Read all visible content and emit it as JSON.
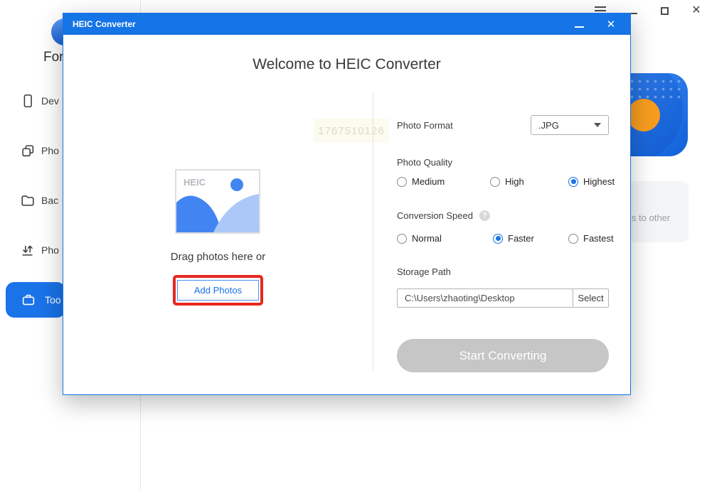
{
  "icons": {
    "close_glyph": "✕",
    "help_glyph": "?"
  },
  "background_app": {
    "logo_text": "For",
    "sidebar_items": [
      {
        "label": "Dev",
        "selected": false
      },
      {
        "label": "Pho",
        "selected": false
      },
      {
        "label": "Bac",
        "selected": false
      },
      {
        "label": "Pho",
        "selected": false
      },
      {
        "label": "Too",
        "selected": true
      }
    ],
    "promo_card_text": "s to other"
  },
  "dialog": {
    "title": "HEIC Converter",
    "heading": "Welcome to HEIC Converter",
    "watermark": "1767510126",
    "left_panel": {
      "thumb_label": "HEIC",
      "drag_text": "Drag photos here or",
      "add_photos_label": "Add Photos"
    },
    "options": {
      "photo_format": {
        "label": "Photo Format",
        "value": ".JPG"
      },
      "photo_quality": {
        "label": "Photo Quality",
        "choices": [
          {
            "label": "Medium",
            "selected": false
          },
          {
            "label": "High",
            "selected": false
          },
          {
            "label": "Highest",
            "selected": true
          }
        ]
      },
      "conversion_speed": {
        "label": "Conversion Speed",
        "choices": [
          {
            "label": "Normal",
            "selected": false
          },
          {
            "label": "Faster",
            "selected": true
          },
          {
            "label": "Fastest",
            "selected": false
          }
        ]
      },
      "storage_path": {
        "label": "Storage Path",
        "value": "C:\\Users\\zhaoting\\Desktop",
        "select_label": "Select"
      }
    },
    "start_button_label": "Start Converting"
  },
  "colors": {
    "titlebar_blue": "#1574e6",
    "selected_blue": "#1a73e8",
    "annotation_red": "#e8271f",
    "disabled_gray": "#c6c6c6"
  }
}
